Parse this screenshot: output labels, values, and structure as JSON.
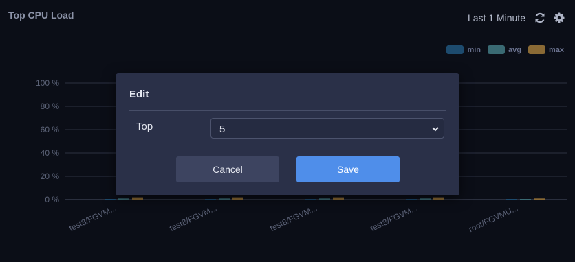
{
  "widget": {
    "title": "Top CPU Load",
    "range_label": "Last 1 Minute",
    "refresh_icon": "refresh-icon",
    "settings_icon": "gear-icon"
  },
  "chart_data": {
    "type": "bar",
    "categories": [
      "test8/FGVM...",
      "test8/FGVM...",
      "test8/FGVM...",
      "test8/FGVM...",
      "root/FGVMU..."
    ],
    "series": [
      {
        "name": "min",
        "color": "#1d4b6e",
        "values": [
          0,
          0,
          0,
          0,
          0
        ]
      },
      {
        "name": "avg",
        "color": "#3a6a73",
        "values": [
          1,
          1,
          1,
          1,
          0
        ]
      },
      {
        "name": "max",
        "color": "#8a6a35",
        "values": [
          2,
          2,
          2,
          2,
          1
        ]
      }
    ],
    "yticks": [
      "100 %",
      "80 %",
      "60 %",
      "40 %",
      "20 %",
      "0 %"
    ],
    "ylim": [
      0,
      100
    ],
    "legend_position": "top-right",
    "grid": true
  },
  "modal": {
    "title": "Edit",
    "field_label": "Top",
    "select_value": "5",
    "cancel_label": "Cancel",
    "save_label": "Save"
  }
}
